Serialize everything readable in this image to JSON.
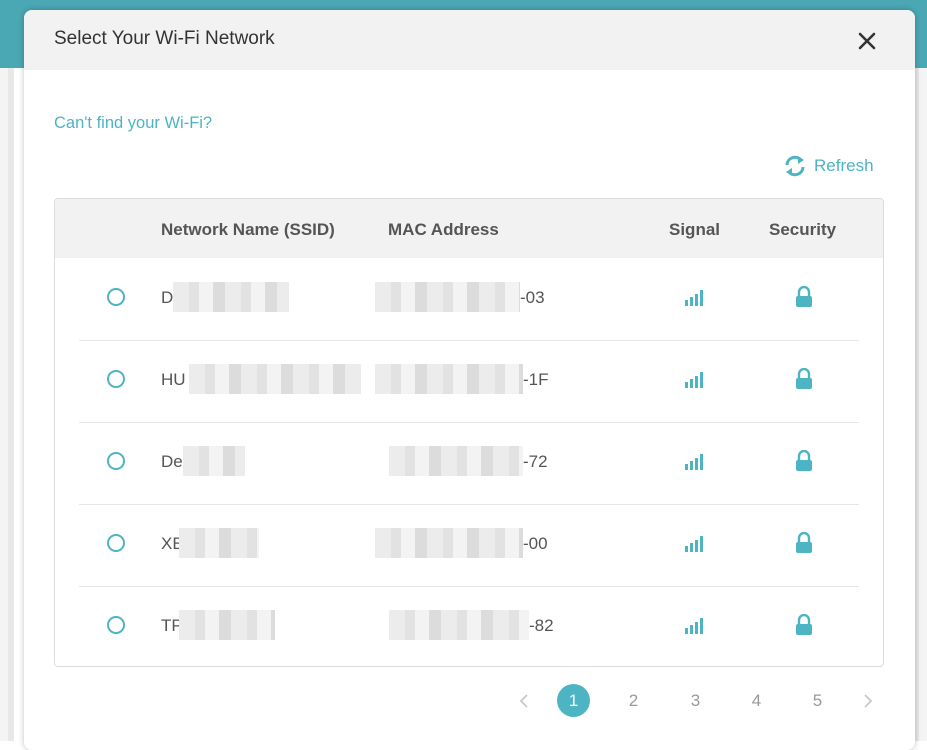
{
  "dialog": {
    "title": "Select Your Wi-Fi Network",
    "link_cant_find": "Can't find your Wi-Fi?",
    "refresh_label": "Refresh"
  },
  "table": {
    "columns": [
      "Network Name (SSID)",
      "MAC Address",
      "Signal",
      "Security"
    ],
    "rows": [
      {
        "ssid": "De",
        "mac_suffix": "-03",
        "signal_icon": "signal-icon",
        "security_icon": "lock-icon"
      },
      {
        "ssid": "HU",
        "mac_suffix": "-1F",
        "signal_icon": "signal-icon",
        "security_icon": "lock-icon"
      },
      {
        "ssid": "De",
        "mac_suffix": "-72",
        "signal_icon": "signal-icon",
        "security_icon": "lock-icon"
      },
      {
        "ssid": "XE",
        "mac_suffix": "-00",
        "signal_icon": "signal-icon",
        "security_icon": "lock-icon"
      },
      {
        "ssid": "TP",
        "mac_suffix": "-82",
        "signal_icon": "signal-icon",
        "security_icon": "lock-icon"
      }
    ]
  },
  "pagination": {
    "pages": [
      "1",
      "2",
      "3",
      "4",
      "5"
    ],
    "current": "1"
  },
  "colors": {
    "accent": "#4db4c3",
    "header_bg": "#f2f2f2",
    "topbar": "#4aa7b4"
  }
}
